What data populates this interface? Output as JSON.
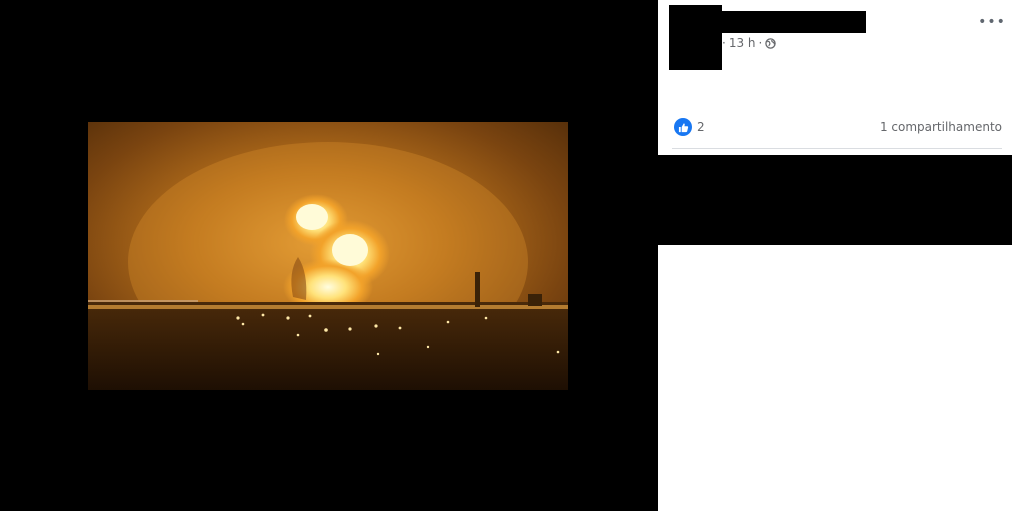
{
  "post": {
    "time": "13 h",
    "separator": "·",
    "audience_icon": "globe-icon",
    "more_icon": "more-options-icon",
    "more_label": "•••"
  },
  "engagement": {
    "reaction_icon": "like-icon",
    "reaction_count": "2",
    "shares_label": "1 compartilhamento"
  },
  "photo": {
    "description_icon": "explosion-photo"
  },
  "colors": {
    "viewer_bg": "#000000",
    "accent": "#1877f2",
    "meta_text": "#65676b"
  }
}
